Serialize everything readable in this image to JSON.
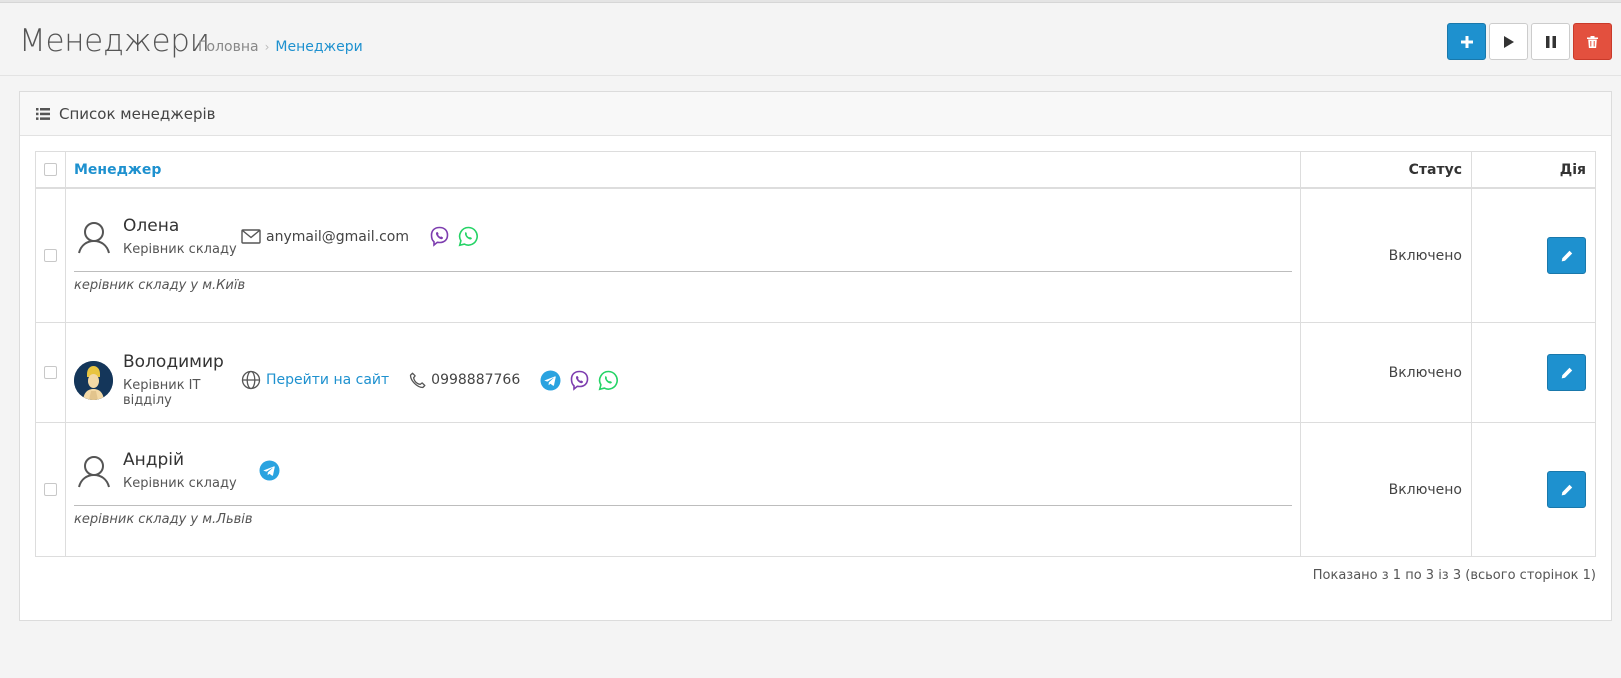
{
  "page": {
    "title": "Менеджери",
    "breadcrumb": {
      "home": "Головна",
      "current": "Менеджери"
    }
  },
  "toolbar": {
    "add_icon": "plus-icon",
    "enable_icon": "play-icon",
    "disable_icon": "pause-icon",
    "delete_icon": "trash-icon"
  },
  "panel": {
    "title": "Список менеджерів",
    "icon": "list-icon"
  },
  "table": {
    "columns": {
      "manager": "Менеджер",
      "status": "Статус",
      "action": "Дія"
    },
    "rows": [
      {
        "name": "Олена",
        "position": "Керівник складу",
        "email": "anymail@gmail.com",
        "messengers": [
          "viber",
          "whatsapp"
        ],
        "note": "керівник складу у м.Київ",
        "status": "Включено"
      },
      {
        "name": "Володимир",
        "position": "Керівник IT відділу",
        "website_label": "Перейти на сайт",
        "phone": "0998887766",
        "messengers": [
          "telegram",
          "viber",
          "whatsapp"
        ],
        "status": "Включено"
      },
      {
        "name": "Андрій",
        "position": "Керівник складу",
        "messengers": [
          "telegram"
        ],
        "note": "керівник складу у м.Львів",
        "status": "Включено"
      }
    ]
  },
  "pagination": {
    "info": "Показано з 1 по 3 із 3 (всього сторінок 1)"
  },
  "colors": {
    "primary": "#1e91cf",
    "danger": "#e3503e",
    "viber": "#7d3daf",
    "whatsapp": "#25d366",
    "telegram": "#2aa3e0"
  }
}
